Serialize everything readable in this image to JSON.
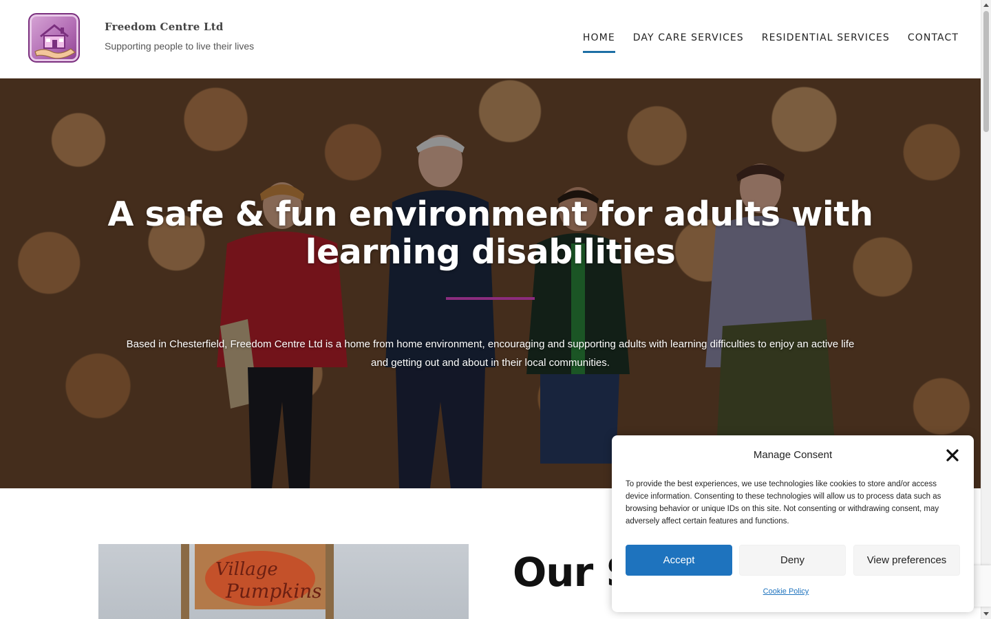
{
  "brand": {
    "name": "Freedom Centre Ltd",
    "tagline": "Supporting people to live their lives"
  },
  "nav": {
    "items": [
      {
        "label": "HOME",
        "active": true
      },
      {
        "label": "DAY CARE SERVICES",
        "active": false
      },
      {
        "label": "RESIDENTIAL SERVICES",
        "active": false
      },
      {
        "label": "CONTACT",
        "active": false
      }
    ]
  },
  "hero": {
    "title": "A safe & fun environment for adults with learning disabilities",
    "text": "Based in Chesterfield, Freedom Centre Ltd is a home from home environment, encouraging and supporting adults with learning difficulties to enjoy an active life and getting out and about in their local communities."
  },
  "services": {
    "heading": "Our S"
  },
  "consent": {
    "title": "Manage Consent",
    "body": "To provide the best experiences, we use technologies like cookies to store and/or access device information. Consenting to these technologies will allow us to process data such as browsing behavior or unique IDs on this site. Not consenting or withdrawing consent, may adversely affect certain features and functions.",
    "accept_label": "Accept",
    "deny_label": "Deny",
    "prefs_label": "View preferences",
    "policy_link": "Cookie Policy"
  },
  "colors": {
    "accent": "#1e73be",
    "nav_underline": "#1d6fa5",
    "hero_divider": "#8b2c7e",
    "logo": "#b46fb6"
  },
  "icons": {
    "logo": "house-in-hand-icon",
    "close": "close-icon"
  }
}
